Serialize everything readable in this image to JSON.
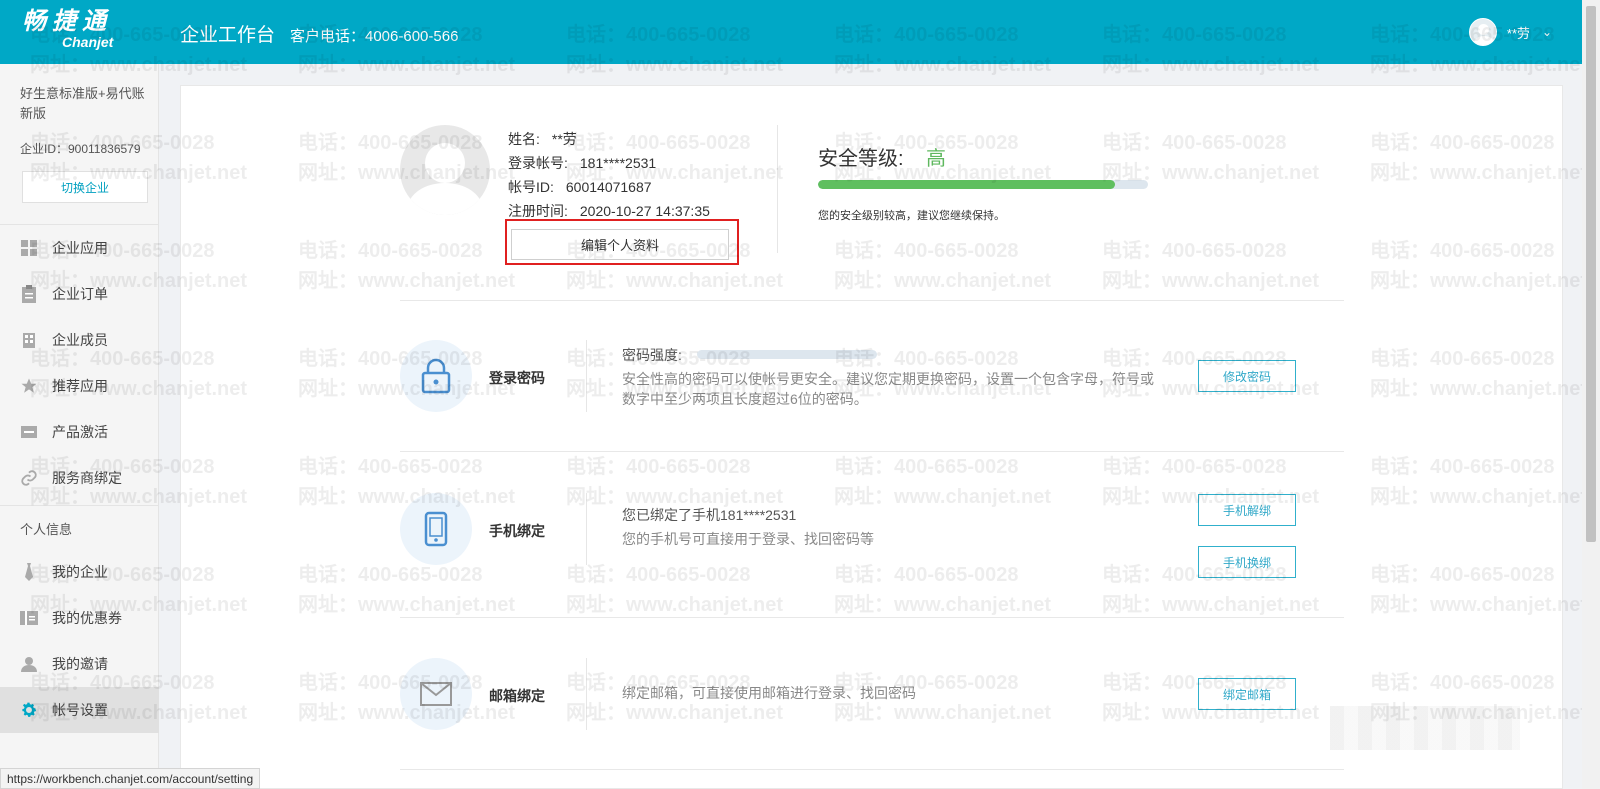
{
  "header": {
    "logo_cn": "畅捷通",
    "logo_en": "Chanjet",
    "workbench": "企业工作台",
    "hotline": "客户电话：4006-600-566",
    "user_name": "**劳",
    "chevron": "⌄"
  },
  "sidebar": {
    "edition": "好生意标准版+易代账新版",
    "company_id": "企业ID：90011836579",
    "switch_label": "切换企业",
    "items": [
      {
        "label": "企业应用",
        "icon": "grid-icon"
      },
      {
        "label": "企业订单",
        "icon": "clipboard-icon"
      },
      {
        "label": "企业成员",
        "icon": "building-icon"
      },
      {
        "label": "推荐应用",
        "icon": "star-icon"
      },
      {
        "label": "产品激活",
        "icon": "card-icon"
      },
      {
        "label": "服务商绑定",
        "icon": "link-icon"
      }
    ],
    "section_personal": "个人信息",
    "personal_items": [
      {
        "label": "我的企业",
        "icon": "tie-icon"
      },
      {
        "label": "我的优惠券",
        "icon": "coupon-icon"
      },
      {
        "label": "我的邀请",
        "icon": "person-icon"
      },
      {
        "label": "帐号设置",
        "icon": "gear-icon"
      }
    ]
  },
  "profile": {
    "name_key": "姓名:",
    "name_val": "**劳",
    "account_key": "登录帐号:",
    "account_val": "181****2531",
    "id_key": "帐号ID:",
    "id_val": "60014071687",
    "reg_key": "注册时间:",
    "reg_val": "2020-10-27 14:37:35",
    "edit_label": "编辑个人资料"
  },
  "security": {
    "title": "安全等级:",
    "level": "高",
    "progress": 0.9,
    "note": "您的安全级别较高，建议您继续保持。"
  },
  "password": {
    "label": "登录密码",
    "strength_label": "密码强度:",
    "desc_line1": "安全性高的密码可以使帐号更安全。建议您定期更换密码，设置一个包含字母，符号或",
    "desc_line2": "数字中至少两项且长度超过6位的密码。",
    "button": "修改密码"
  },
  "phone": {
    "label": "手机绑定",
    "bound_text": "您已绑定了手机181****2531",
    "desc": "您的手机号可直接用于登录、找回密码等",
    "unbind_button": "手机解绑",
    "change_button": "手机换绑"
  },
  "email": {
    "label": "邮箱绑定",
    "desc": "绑定邮箱，可直接使用邮箱进行登录、找回密码",
    "button": "绑定邮箱"
  },
  "status_url": "https://workbench.chanjet.com/account/setting",
  "watermark": {
    "line1": "电话：400-665-0028",
    "line2": "网址：www.chanjet.net"
  }
}
